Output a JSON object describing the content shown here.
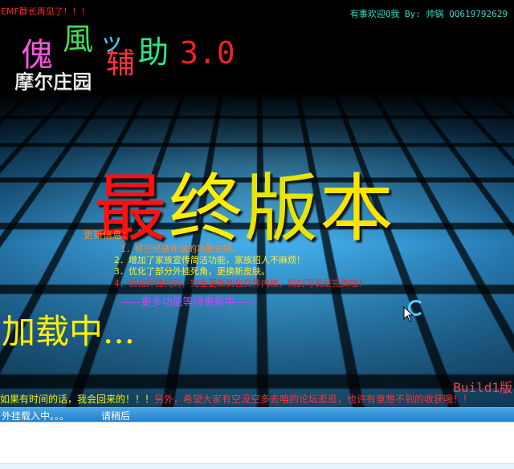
{
  "header": {
    "top_left_notice": "EMF群长再见了！！！",
    "top_right_contact": "有事欢迎Q我 By: 帅锅   QQ619792629"
  },
  "logo": {
    "char_1": "傀",
    "char_2": "風",
    "char_3": "ッ",
    "char_4": "辅",
    "char_5": "助",
    "version": "3.0",
    "subtitle": "摩尔庄园"
  },
  "headline": {
    "c1": "最",
    "c2": "终",
    "c3": "版",
    "c4": "本"
  },
  "updates": {
    "title": "更新信息：",
    "items": [
      "1．修已经被和谐的功能去掉。",
      "2．增加了家族宣传简洁功能，家族招人不麻烦！",
      "3．优化了部分外挂死角，更换新皮肤。",
      "4．优化外挂代码，完全更新到包文件内核，彻封可说是完美啦！"
    ],
    "more": "-----更多功能等待更新中-----"
  },
  "loading_text": "加载中...",
  "build_label": "Build1版",
  "footer_message": {
    "part_a": "如果有时间的话，我会回来的！！！",
    "part_b": "另外，希望大家有空没空多去咱的论坛逛逛，也许有意想不到的收获哦！！"
  },
  "statusbar": {
    "left": "外挂载入中。。。",
    "right": "请稍后"
  },
  "colors": {
    "statusbar": "#1f7dc6",
    "headline_red": "#ff1111",
    "headline_yellow": "#ffee00"
  }
}
